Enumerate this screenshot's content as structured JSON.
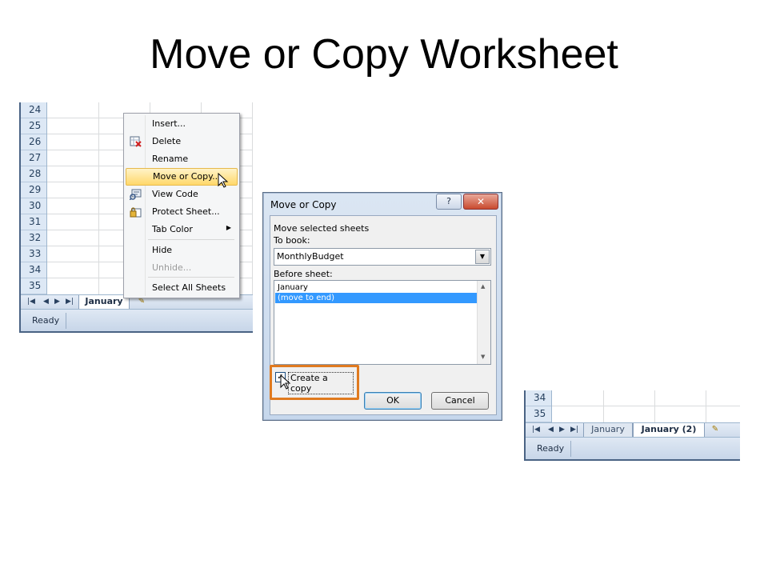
{
  "slide": {
    "title": "Move or Copy Worksheet"
  },
  "excel_left": {
    "row_numbers": [
      "24",
      "25",
      "26",
      "27",
      "28",
      "29",
      "30",
      "31",
      "32",
      "33",
      "34",
      "35"
    ],
    "sheet_tab": "January",
    "status": "Ready"
  },
  "context_menu": {
    "items": [
      {
        "label": "Insert...",
        "icon": ""
      },
      {
        "label": "Delete",
        "icon": "delete-sheet-icon"
      },
      {
        "label": "Rename",
        "icon": ""
      },
      {
        "label": "Move or Copy...",
        "icon": "",
        "highlighted": true
      },
      {
        "label": "View Code",
        "icon": "view-code-icon"
      },
      {
        "label": "Protect Sheet...",
        "icon": "protect-sheet-icon"
      },
      {
        "label": "Tab Color",
        "icon": "",
        "submenu": true
      },
      {
        "label": "Hide",
        "icon": ""
      },
      {
        "label": "Unhide...",
        "icon": "",
        "disabled": true
      },
      {
        "label": "Select All Sheets",
        "icon": ""
      }
    ]
  },
  "dialog": {
    "title": "Move or Copy",
    "help": "?",
    "close": "✕",
    "move_selected_label": "Move selected sheets",
    "to_book_label": "To book:",
    "to_book_value": "MonthlyBudget",
    "before_sheet_label": "Before sheet:",
    "before_sheet_options": [
      "January",
      "(move to end)"
    ],
    "selected_option": "(move to end)",
    "create_copy_label": "Create a copy",
    "create_copy_checked": true,
    "ok_label": "OK",
    "cancel_label": "Cancel",
    "highlight_color": "#e07a1f"
  },
  "excel_right": {
    "row_numbers": [
      "34",
      "35"
    ],
    "tabs": [
      "January",
      "January (2)"
    ],
    "active_tab": "January (2)",
    "status": "Ready"
  }
}
